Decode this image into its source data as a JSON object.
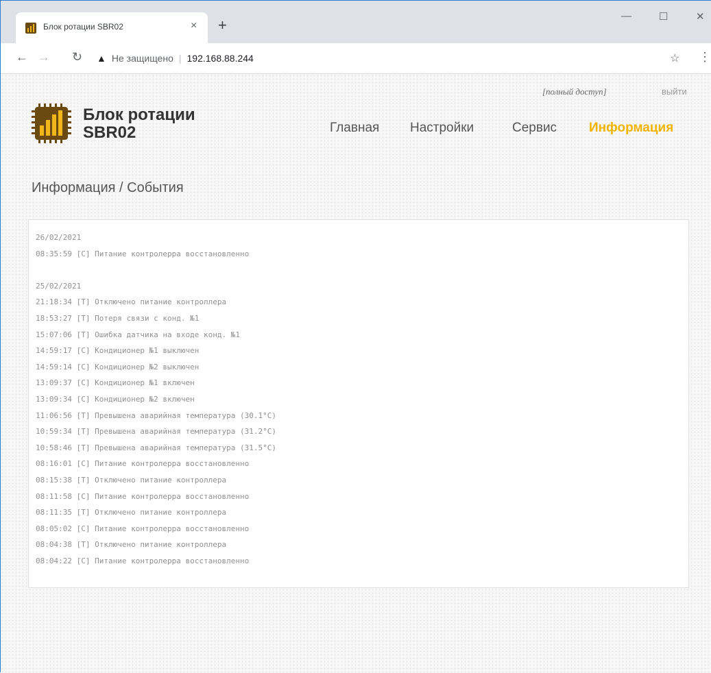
{
  "browser": {
    "tab_title": "Блок ротации SBR02",
    "tab_close": "×",
    "new_tab": "+",
    "minimize": "—",
    "maximize": "☐",
    "close": "✕",
    "not_secure": "Не защищено",
    "separator": "|",
    "url": "192.168.88.244"
  },
  "header": {
    "access": "[полный доступ]",
    "logout": "выйти",
    "brand_line1": "Блок ротации",
    "brand_line2": "SBR02",
    "nav": [
      "Главная",
      "Настройки",
      "Сервис",
      "Информация"
    ],
    "active_nav": "Информация"
  },
  "breadcrumb": "Информация / События",
  "events": {
    "day1": {
      "date": "26/02/2021",
      "rows": [
        "08:35:59 [C] Питание контролерра восстановленно"
      ]
    },
    "day2": {
      "date": "25/02/2021",
      "rows": [
        "21:18:34 [T] Отключено питание контроллера",
        "18:53:27 [T] Потеря связи с конд. №1",
        "15:07:06 [T] Ошибка датчика на входе конд. №1",
        "14:59:17 [C] Кондиционер №1 выключен",
        "14:59:14 [C] Кондиционер №2 выключен",
        "13:09:37 [C] Кондиционер №1 включен",
        "13:09:34 [C] Кондиционер №2 включен",
        "11:06:56 [T] Превышена аварийная температура (30.1°C)",
        "10:59:34 [T] Превышена аварийная температура (31.2°C)",
        "10:58:46 [T] Превышена аварийная температура (31.5°C)",
        "08:16:01 [C] Питание контролерра восстановленно",
        "08:15:38 [T] Отключено питание контроллера",
        "08:11:58 [C] Питание контролерра восстановленно",
        "08:11:35 [T] Отключено питание контроллера",
        "08:05:02 [C] Питание контролерра восстановленно",
        "08:04:38 [T] Отключено питание контроллера",
        "08:04:22 [C] Питание контролерра восстановленно"
      ]
    }
  },
  "colors": {
    "accent": "#f2b400",
    "logo_brown": "#6b4a12",
    "logo_gold": "#f1b71a"
  },
  "icons": [
    "favicon-icon",
    "back-arrow-icon",
    "forward-arrow-icon",
    "reload-icon",
    "warning-icon",
    "star-icon",
    "menu-dots-icon",
    "logo-icon"
  ]
}
